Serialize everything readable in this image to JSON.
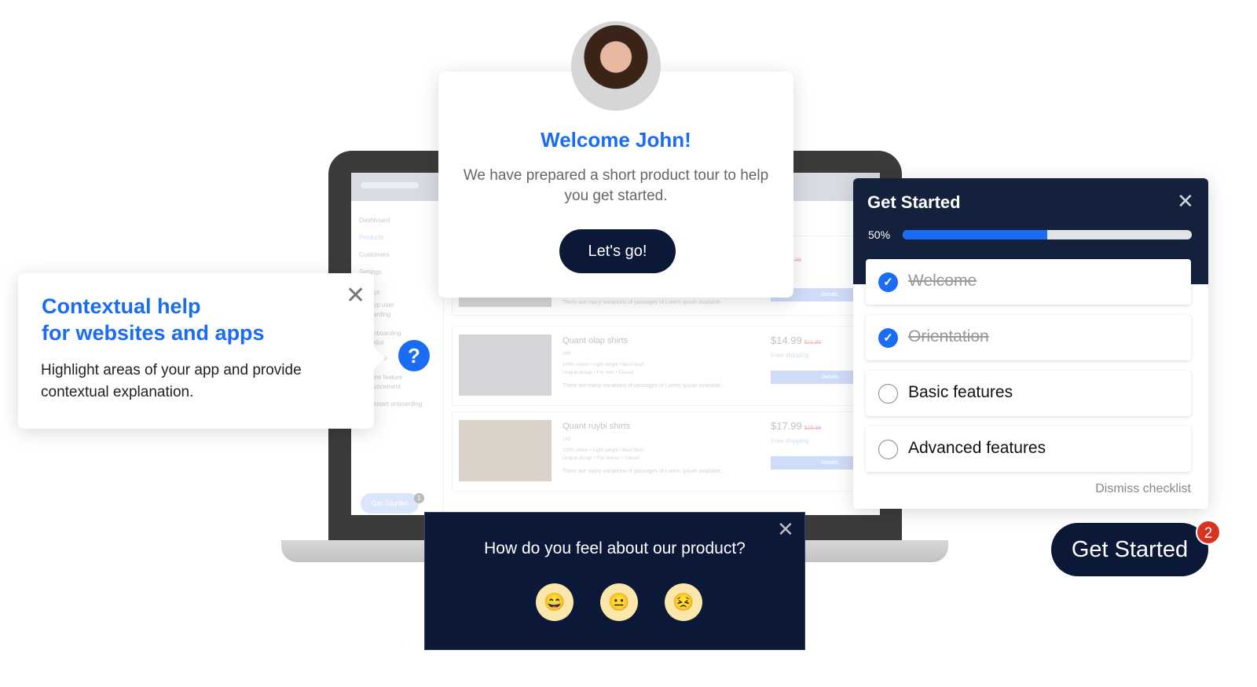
{
  "laptop": {
    "sidebar": [
      "Dashboard",
      "Products",
      "Customers",
      "Settings",
      "ps",
      "pp user",
      "arding",
      "nboarding",
      "klist",
      "ance",
      "ew feature",
      "uncement",
      "estart onboarding"
    ],
    "products": [
      {
        "name": "",
        "desc": "There are many variations of passages of Lorem Ipsum available...",
        "price": "99",
        "old": "$20.99",
        "ship": "ipping",
        "btn": "Details"
      },
      {
        "name": "Quant olap shirts",
        "count": "289",
        "f1": "100% cotton • Light weight • Best finish",
        "f2": "Unique design • For men • Casual",
        "desc": "There are many variations of passages of Lorem Ipsum available...",
        "price": "$14.99",
        "old": "$21.99",
        "ship": "Free shipping",
        "btn": "Details"
      },
      {
        "name": "Quant ruybi shirts",
        "count": "145",
        "f1": "100% cotton • Light weight • Best finish",
        "f2": "Unique design • For women • Casual",
        "desc": "There are many variations of passages of Lorem Ipsum available...",
        "price": "$17.99",
        "old": "$25.99",
        "ship": "Free shipping",
        "btn": "Details"
      }
    ],
    "get_started": "Get Started",
    "badge": "1"
  },
  "welcome": {
    "title": "Welcome John!",
    "text": "We have prepared a short product tour to help you get started.",
    "button": "Let's go!"
  },
  "help": {
    "title_line1": "Contextual help",
    "title_line2": "for websites and apps",
    "text": "Highlight areas of your app and provide contextual explanation.",
    "close": "✕",
    "hotspot": "?"
  },
  "checklist": {
    "title": "Get Started",
    "close": "✕",
    "progress_label": "50%",
    "progress": 0.5,
    "items": [
      {
        "label": "Welcome",
        "done": true
      },
      {
        "label": "Orientation",
        "done": true
      },
      {
        "label": "Basic features",
        "done": false
      },
      {
        "label": "Advanced features",
        "done": false
      }
    ],
    "dismiss": "Dismiss checklist"
  },
  "launcher": {
    "label": "Get Started",
    "badge": "2"
  },
  "feedback": {
    "question": "How do you feel about our product?",
    "close": "✕",
    "emojis": [
      "😄",
      "😐",
      "😣"
    ]
  },
  "colors": {
    "accent": "#1a6cf5",
    "navy": "#0b1838",
    "checklist_header": "#14213d",
    "badge": "#d9321f"
  }
}
